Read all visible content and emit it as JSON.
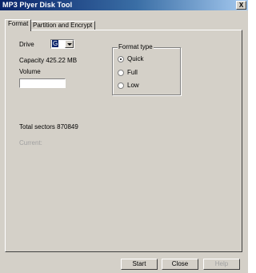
{
  "window": {
    "title": "MP3 Plyer Disk Tool",
    "close_glyph": "X"
  },
  "tabs": [
    {
      "label": "Format",
      "active": true
    },
    {
      "label": "Partition and Encrypt",
      "active": false
    }
  ],
  "format": {
    "drive_label": "Drive",
    "drive_value": "G",
    "capacity_text": "Capacity 425.22 MB",
    "volume_label": "Volume",
    "volume_value": "",
    "total_sectors_text": "Total sectors 870849",
    "current_label": "Current:",
    "format_type": {
      "title": "Format type",
      "options": [
        {
          "label": "Quick",
          "checked": true
        },
        {
          "label": "Full",
          "checked": false
        },
        {
          "label": "Low",
          "checked": false
        }
      ]
    }
  },
  "buttons": {
    "start": "Start",
    "close": "Close",
    "help": "Help",
    "help_enabled": false
  }
}
